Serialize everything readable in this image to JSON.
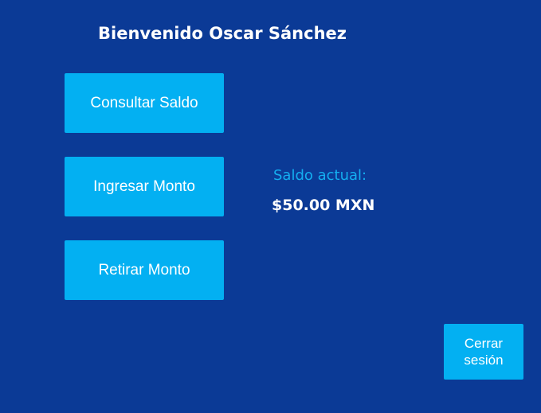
{
  "header": {
    "title": "Bienvenido Oscar Sánchez"
  },
  "actions": {
    "consultar_saldo": "Consultar Saldo",
    "ingresar_monto": "Ingresar Monto",
    "retirar_monto": "Retirar Monto",
    "cerrar_sesion": "Cerrar sesión"
  },
  "balance": {
    "label": "Saldo actual:",
    "value": "$50.00 MXN"
  },
  "colors": {
    "background": "#0b3a96",
    "button": "#03b0f2",
    "label_accent": "#14aef0",
    "text": "#ffffff"
  }
}
